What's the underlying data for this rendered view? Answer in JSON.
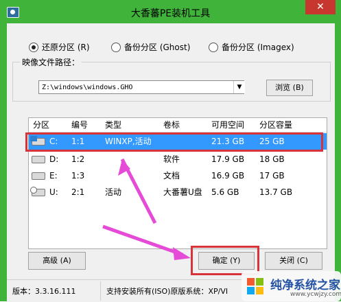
{
  "window": {
    "title": "大香蕃PE装机工具",
    "close_icon": "close-icon"
  },
  "options": {
    "restore": "还原分区 (R)",
    "backup_ghost": "备份分区 (Ghost)",
    "backup_imagex": "备份分区 (Imagex)",
    "selected": "restore"
  },
  "image_path": {
    "label": "映像文件路径：",
    "value": "Z:\\windows\\windows.GHO",
    "browse": "浏览 (B)"
  },
  "table": {
    "headers": [
      "分区",
      "编号",
      "类型",
      "卷标",
      "可用空间",
      "分区容量"
    ],
    "rows": [
      {
        "drive": "C:",
        "num": "1:1",
        "type": "WINXP,活动",
        "label": "",
        "free": "21.3 GB",
        "size": "25 GB",
        "selected": true
      },
      {
        "drive": "D:",
        "num": "1:2",
        "type": "",
        "label": "软件",
        "free": "17.9 GB",
        "size": "18 GB",
        "selected": false
      },
      {
        "drive": "E:",
        "num": "1:3",
        "type": "",
        "label": "文档",
        "free": "16.9 GB",
        "size": "17 GB",
        "selected": false
      },
      {
        "drive": "U:",
        "num": "2:1",
        "type": "活动",
        "label": "大番薯U盘",
        "free": "5.6 GB",
        "size": "13.7 GB",
        "selected": false
      }
    ]
  },
  "buttons": {
    "advanced": "高级 (A)",
    "ok": "确定 (Y)",
    "close": "关闭 (C)"
  },
  "status": {
    "version": "版本：3.3.16.111",
    "support": "支持安装所有(ISO)原版系统：XP/VI"
  },
  "watermark": {
    "text": "纯净系统之家",
    "url": "www.ycwjzy.com"
  },
  "colors": {
    "titlebar": "#3fb33a",
    "selection": "#3399ff",
    "highlight_box": "#d8333a",
    "arrow": "#e64bd7"
  }
}
